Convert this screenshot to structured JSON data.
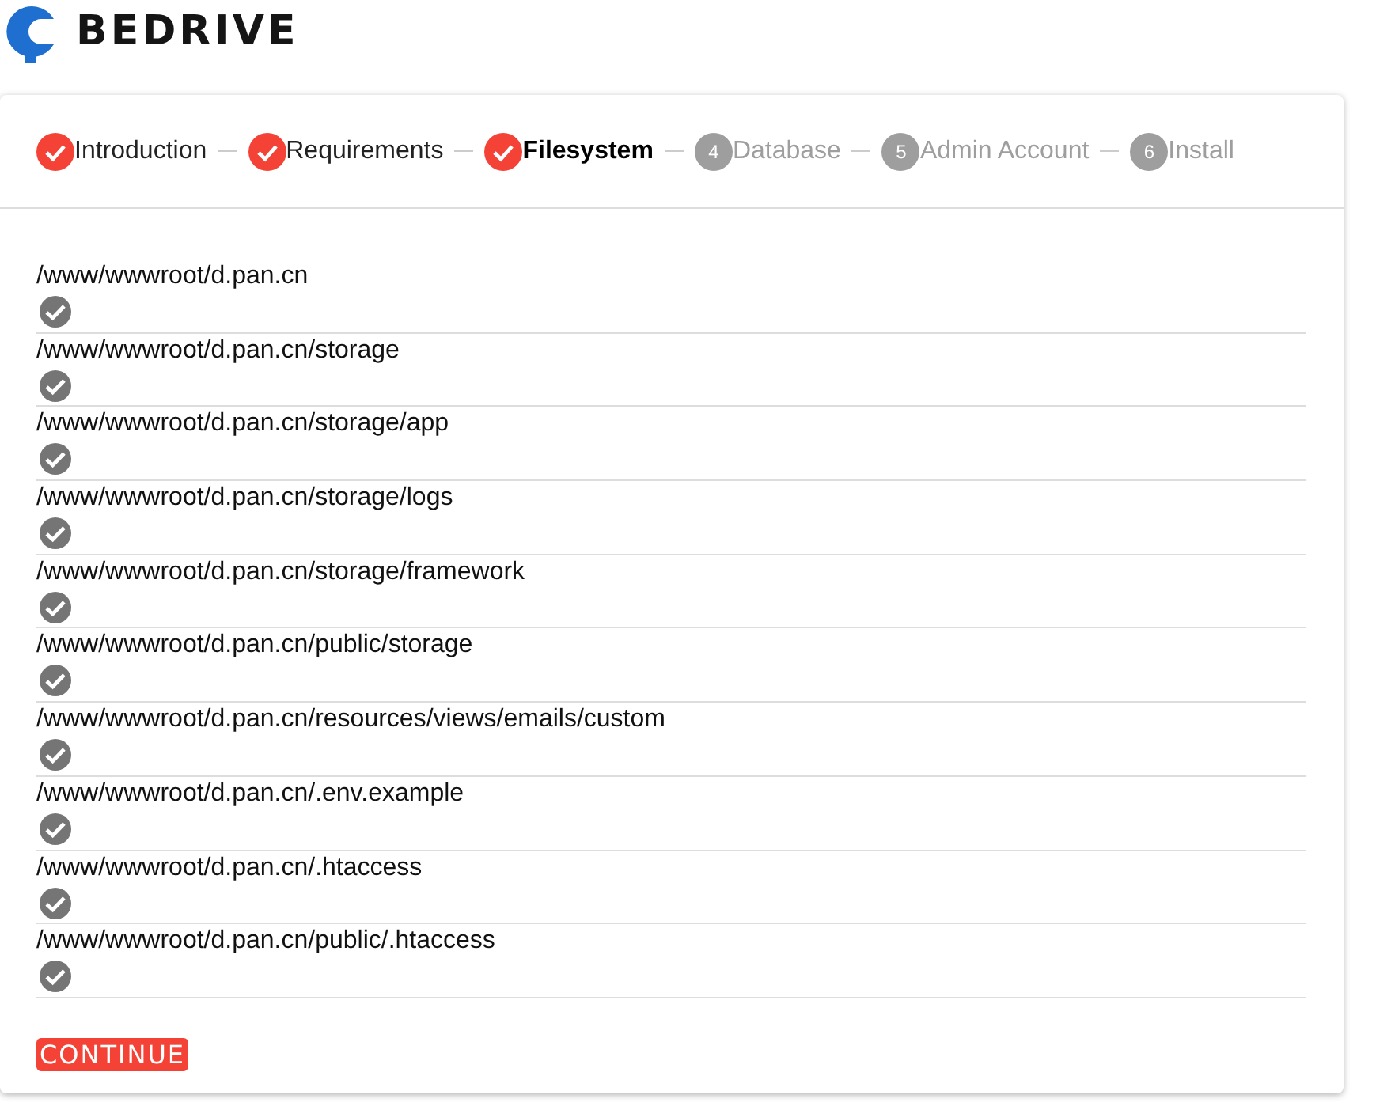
{
  "logo": {
    "text": "BEDRIVE"
  },
  "steps": [
    {
      "label": "Introduction",
      "done": true,
      "selected": false
    },
    {
      "label": "Requirements",
      "done": true,
      "selected": false
    },
    {
      "label": "Filesystem",
      "done": true,
      "selected": true
    },
    {
      "label": "Database",
      "number": "4",
      "done": false,
      "selected": false
    },
    {
      "label": "Admin Account",
      "number": "5",
      "done": false,
      "selected": false
    },
    {
      "label": "Install",
      "number": "6",
      "done": false,
      "selected": false
    }
  ],
  "paths": [
    {
      "path": "/www/wwwroot/d.pan.cn",
      "writable": true
    },
    {
      "path": "/www/wwwroot/d.pan.cn/storage",
      "writable": true
    },
    {
      "path": "/www/wwwroot/d.pan.cn/storage/app",
      "writable": true
    },
    {
      "path": "/www/wwwroot/d.pan.cn/storage/logs",
      "writable": true
    },
    {
      "path": "/www/wwwroot/d.pan.cn/storage/framework",
      "writable": true
    },
    {
      "path": "/www/wwwroot/d.pan.cn/public/storage",
      "writable": true
    },
    {
      "path": "/www/wwwroot/d.pan.cn/resources/views/emails/custom",
      "writable": true
    },
    {
      "path": "/www/wwwroot/d.pan.cn/.env.example",
      "writable": true
    },
    {
      "path": "/www/wwwroot/d.pan.cn/.htaccess",
      "writable": true
    },
    {
      "path": "/www/wwwroot/d.pan.cn/public/.htaccess",
      "writable": true
    }
  ],
  "continue_button": "CONTINUE"
}
